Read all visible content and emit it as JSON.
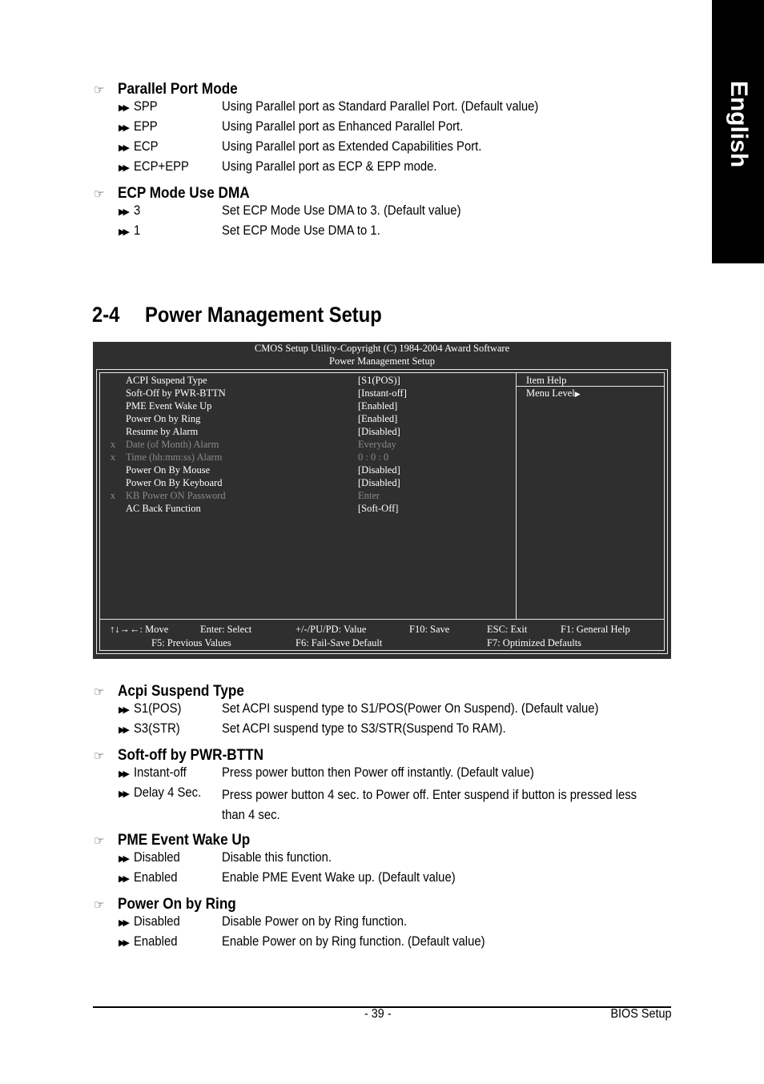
{
  "side_tab": {
    "label": "English"
  },
  "top_sections": [
    {
      "title": "Parallel Port Mode",
      "options": [
        {
          "name": "SPP",
          "desc": "Using Parallel port as Standard Parallel Port. (Default value)"
        },
        {
          "name": "EPP",
          "desc": "Using Parallel port as Enhanced Parallel Port."
        },
        {
          "name": "ECP",
          "desc": "Using Parallel port as Extended Capabilities Port."
        },
        {
          "name": "ECP+EPP",
          "desc": "Using Parallel port as ECP & EPP mode."
        }
      ]
    },
    {
      "title": "ECP Mode Use DMA",
      "options": [
        {
          "name": "3",
          "desc": "Set ECP Mode Use DMA to 3. (Default value)"
        },
        {
          "name": "1",
          "desc": "Set ECP Mode Use DMA to 1."
        }
      ]
    }
  ],
  "chapter": {
    "number": "2-4",
    "title": "Power Management Setup"
  },
  "bios": {
    "header_line1": "CMOS Setup Utility-Copyright (C) 1984-2004 Award Software",
    "header_line2": "Power Management Setup",
    "items": [
      {
        "marker": "",
        "label": "ACPI Suspend Type",
        "value": "[S1(POS)]",
        "disabled": false
      },
      {
        "marker": "",
        "label": "Soft-Off by PWR-BTTN",
        "value": "[Instant-off]",
        "disabled": false
      },
      {
        "marker": "",
        "label": "PME Event Wake Up",
        "value": "[Enabled]",
        "disabled": false
      },
      {
        "marker": "",
        "label": "Power On by Ring",
        "value": "[Enabled]",
        "disabled": false
      },
      {
        "marker": "",
        "label": "Resume by Alarm",
        "value": "[Disabled]",
        "disabled": false
      },
      {
        "marker": "x",
        "label": "Date (of Month) Alarm",
        "value": "Everyday",
        "disabled": true
      },
      {
        "marker": "x",
        "label": "Time (hh:mm:ss) Alarm",
        "value": "0 : 0 : 0",
        "disabled": true
      },
      {
        "marker": "",
        "label": "Power On By Mouse",
        "value": "[Disabled]",
        "disabled": false
      },
      {
        "marker": "",
        "label": "Power On By Keyboard",
        "value": "[Disabled]",
        "disabled": false
      },
      {
        "marker": "x",
        "label": "KB Power ON Password",
        "value": "Enter",
        "disabled": true
      },
      {
        "marker": "",
        "label": "AC Back Function",
        "value": "[Soft-Off]",
        "disabled": false
      }
    ],
    "help_title": "Item Help",
    "menu_level": "Menu Level",
    "menu_level_icon": "right-triangle-icon",
    "keys": {
      "move": "↑↓→←: Move",
      "enter": "Enter: Select",
      "value": "+/-/PU/PD: Value",
      "f10": "F10: Save",
      "esc": "ESC: Exit",
      "f1": "F1: General Help",
      "f5": "F5: Previous Values",
      "f6": "F6: Fail-Save Default",
      "f7": "F7: Optimized Defaults"
    }
  },
  "bottom_sections": [
    {
      "title": "Acpi Suspend Type",
      "options": [
        {
          "name": "S1(POS)",
          "desc": "Set ACPI suspend type to S1/POS(Power On Suspend). (Default value)"
        },
        {
          "name": "S3(STR)",
          "desc": "Set ACPI suspend type to S3/STR(Suspend To RAM)."
        }
      ]
    },
    {
      "title": "Soft-off by PWR-BTTN",
      "options": [
        {
          "name": "Instant-off",
          "desc": "Press power button then Power off instantly. (Default value)"
        },
        {
          "name": "Delay 4 Sec.",
          "desc": "Press power button 4 sec. to Power off. Enter suspend if button is pressed less than 4 sec."
        }
      ]
    },
    {
      "title": "PME Event Wake Up",
      "options": [
        {
          "name": "Disabled",
          "desc": "Disable this function."
        },
        {
          "name": "Enabled",
          "desc": "Enable PME Event Wake up. (Default value)"
        }
      ]
    },
    {
      "title": "Power On by Ring",
      "options": [
        {
          "name": "Disabled",
          "desc": "Disable Power on by Ring function."
        },
        {
          "name": "Enabled",
          "desc": "Enable Power on by Ring function. (Default value)"
        }
      ]
    }
  ],
  "footer": {
    "page_number": "- 39 -",
    "section": "BIOS Setup"
  },
  "icons": {
    "section_marker": "pointing-hand-icon",
    "option_marker": "double-arrow-icon"
  }
}
